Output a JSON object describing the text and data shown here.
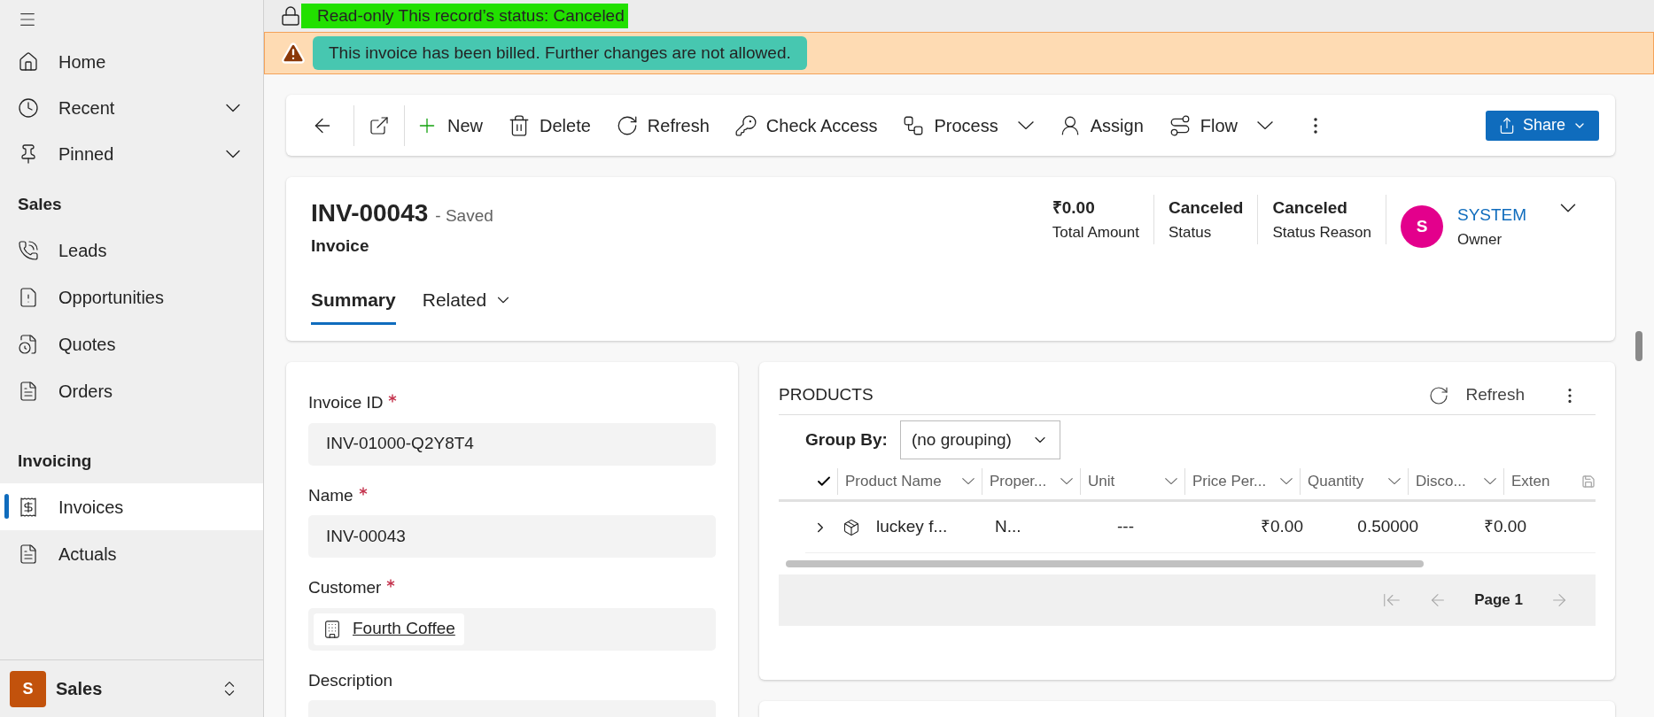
{
  "sidebar": {
    "top_items": [
      {
        "label": "Home",
        "expandable": false
      },
      {
        "label": "Recent",
        "expandable": true
      },
      {
        "label": "Pinned",
        "expandable": true
      }
    ],
    "groups": [
      {
        "title": "Sales",
        "items": [
          {
            "label": "Leads",
            "selected": false
          },
          {
            "label": "Opportunities",
            "selected": false
          },
          {
            "label": "Quotes",
            "selected": false
          },
          {
            "label": "Orders",
            "selected": false
          }
        ]
      },
      {
        "title": "Invoicing",
        "items": [
          {
            "label": "Invoices",
            "selected": true
          },
          {
            "label": "Actuals",
            "selected": false
          }
        ]
      }
    ],
    "area": {
      "initial": "S",
      "label": "Sales"
    }
  },
  "notices": {
    "readonly": "Read-only This record’s status: Canceled",
    "warning": "This invoice has been billed. Further changes are not allowed."
  },
  "toolbar": {
    "items": [
      {
        "label": "New",
        "dropdown": false
      },
      {
        "label": "Delete",
        "dropdown": false
      },
      {
        "label": "Refresh",
        "dropdown": false
      },
      {
        "label": "Check Access",
        "dropdown": false
      },
      {
        "label": "Process",
        "dropdown": true
      },
      {
        "label": "Assign",
        "dropdown": false
      },
      {
        "label": "Flow",
        "dropdown": true
      }
    ],
    "share": "Share"
  },
  "header": {
    "title": "INV-00043",
    "saved": "- Saved",
    "entity": "Invoice",
    "fields": [
      {
        "value": "₹0.00",
        "label": "Total Amount"
      },
      {
        "value": "Canceled",
        "label": "Status"
      },
      {
        "value": "Canceled",
        "label": "Status Reason"
      }
    ],
    "owner": {
      "initial": "S",
      "name": "SYSTEM",
      "label": "Owner"
    },
    "tabs": [
      {
        "label": "Summary",
        "selected": true,
        "dropdown": false
      },
      {
        "label": "Related",
        "selected": false,
        "dropdown": true
      }
    ]
  },
  "form": {
    "fields": [
      {
        "label": "Invoice ID",
        "required": true,
        "kind": "text",
        "value": "INV-01000-Q2Y8T4"
      },
      {
        "label": "Name",
        "required": true,
        "kind": "text",
        "value": "INV-00043"
      },
      {
        "label": "Customer",
        "required": true,
        "kind": "lookup",
        "value": "Fourth Coffee"
      },
      {
        "label": "Description",
        "required": false,
        "kind": "text"
      }
    ]
  },
  "products": {
    "title": "PRODUCTS",
    "refresh": "Refresh",
    "group_by_label": "Group By:",
    "group_by_value": "(no grouping)",
    "columns": [
      "Product Name",
      "Proper...",
      "Unit",
      "Price Per...",
      "Quantity",
      "Disco...",
      "Exten"
    ],
    "rows": [
      {
        "cells": [
          "luckey f...",
          "N...",
          "---",
          "₹0.00",
          "0.50000",
          "₹0.00"
        ]
      }
    ],
    "page": "Page 1"
  }
}
